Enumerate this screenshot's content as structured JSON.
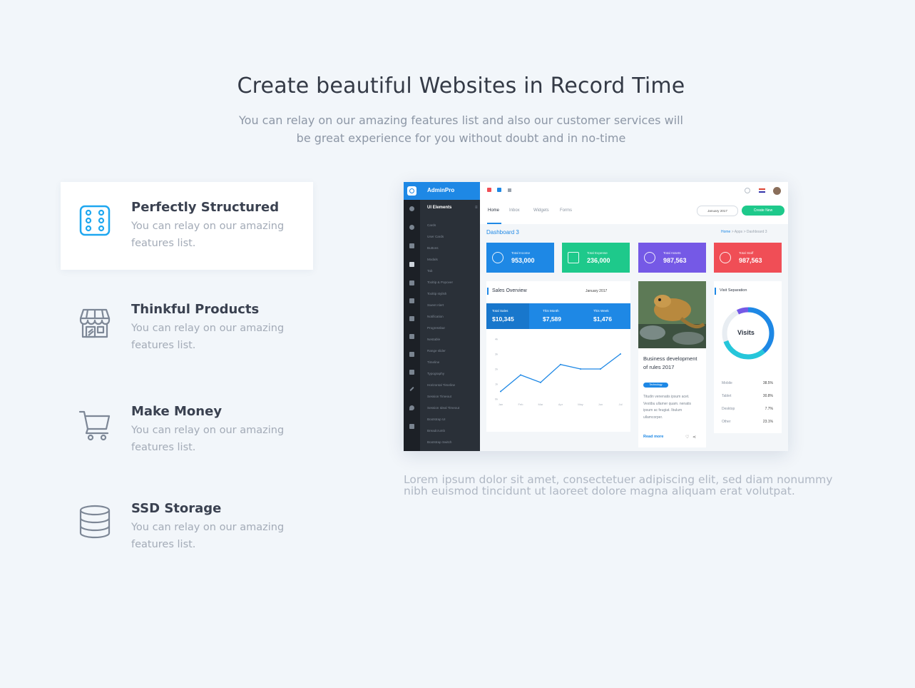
{
  "hero": {
    "title": "Create beautiful Websites in Record Time",
    "subtitle": "You can relay on our amazing features list and also our customer services will be great experience for you without doubt and in no-time"
  },
  "features": [
    {
      "title": "Perfectly Structured",
      "desc": "You can relay on our amazing features list.",
      "icon": "grid-dots-icon",
      "active": true
    },
    {
      "title": "Thinkful Products",
      "desc": "You can relay on our amazing features list.",
      "icon": "storefront-icon",
      "active": false
    },
    {
      "title": "Make Money",
      "desc": "You can relay on our amazing features list.",
      "icon": "shopping-cart-icon",
      "active": false
    },
    {
      "title": "SSD Storage",
      "desc": "You can relay on our amazing features list.",
      "icon": "database-icon",
      "active": false
    }
  ],
  "lorem": "Lorem ipsum dolor sit amet, consectetuer adipiscing elit, sed diam nonummy nibh euismod tincidunt ut laoreet dolore magna aliquam erat volutpat.",
  "colors": {
    "accent": "#1e88e5",
    "icon_active": "#1ea7f0",
    "icon_inactive": "#7d8796",
    "green": "#1ec98b",
    "purple": "#7559e6",
    "red": "#f04e56"
  },
  "dashboard": {
    "brand": "AdminPro",
    "sidebar_title": "UI Elements",
    "sidebar_items": [
      "Cards",
      "User Cards",
      "Buttons",
      "Modals",
      "Tab",
      "Tooltip & Popover",
      "Tooltip stylish",
      "Sweet Alert",
      "Notification",
      "Progressbar",
      "Nestable",
      "Range slider",
      "Timeline",
      "Typography",
      "Horizontal Timeline",
      "Session Timeout",
      "Session Ideal Timeout",
      "Bootstrap UI",
      "Breadcrumb",
      "Bootstrap Switch"
    ],
    "tabs": [
      "Home",
      "Inbox",
      "Widgets",
      "Forms"
    ],
    "date_select": "January 2017",
    "create_button": "Create New",
    "page_title": "Dashboard 3",
    "breadcrumb": [
      "Home",
      "Apps",
      "Dashboard 3"
    ],
    "stats": [
      {
        "label": "Total Income",
        "value": "953,000",
        "color": "#1e88e5"
      },
      {
        "label": "Total Expense",
        "value": "236,000",
        "color": "#1ec98b"
      },
      {
        "label": "Total Assets",
        "value": "987,563",
        "color": "#7559e6"
      },
      {
        "label": "Total Staff",
        "value": "987,563",
        "color": "#f04e56"
      }
    ],
    "sales": {
      "title": "Sales Overview",
      "date": "January 2017",
      "totals": [
        {
          "label": "Total Sales",
          "value": "$10,345"
        },
        {
          "label": "This Month",
          "value": "$7,589"
        },
        {
          "label": "This Week",
          "value": "$1,476"
        }
      ],
      "y_ticks": [
        "4k",
        "3k",
        "2k",
        "1k",
        "0k"
      ],
      "x_ticks": [
        "Jan",
        "Feb",
        "Mar",
        "Apr",
        "May",
        "Jun",
        "Jul"
      ]
    },
    "post": {
      "title": "Business development of rules 2017",
      "tag": "Technology",
      "text": "Titudin venenatis ipsum acet. Vestibu ullamer quam. nenatis ipsum ac feugiat. Ibulum ullamcorper.",
      "read_more": "Read more"
    },
    "visits": {
      "title": "Visit Separation",
      "center_label": "Visits",
      "rows": [
        {
          "label": "Mobile",
          "value": "38.5%"
        },
        {
          "label": "Tablet",
          "value": "30.8%"
        },
        {
          "label": "Desktop",
          "value": "7.7%"
        },
        {
          "label": "Other",
          "value": "23.1%"
        }
      ]
    }
  },
  "chart_data": {
    "type": "line",
    "x": [
      "Jan",
      "Feb",
      "Mar",
      "Apr",
      "May",
      "Jun",
      "Jul"
    ],
    "series": [
      {
        "values": [
          0.5,
          1.6,
          1.1,
          2.3,
          2.0,
          2.0,
          3.0
        ]
      }
    ],
    "ylim": [
      0,
      4
    ],
    "y_ticks": [
      "4k",
      "3k",
      "2k",
      "1k",
      "0k"
    ],
    "grid": false
  }
}
